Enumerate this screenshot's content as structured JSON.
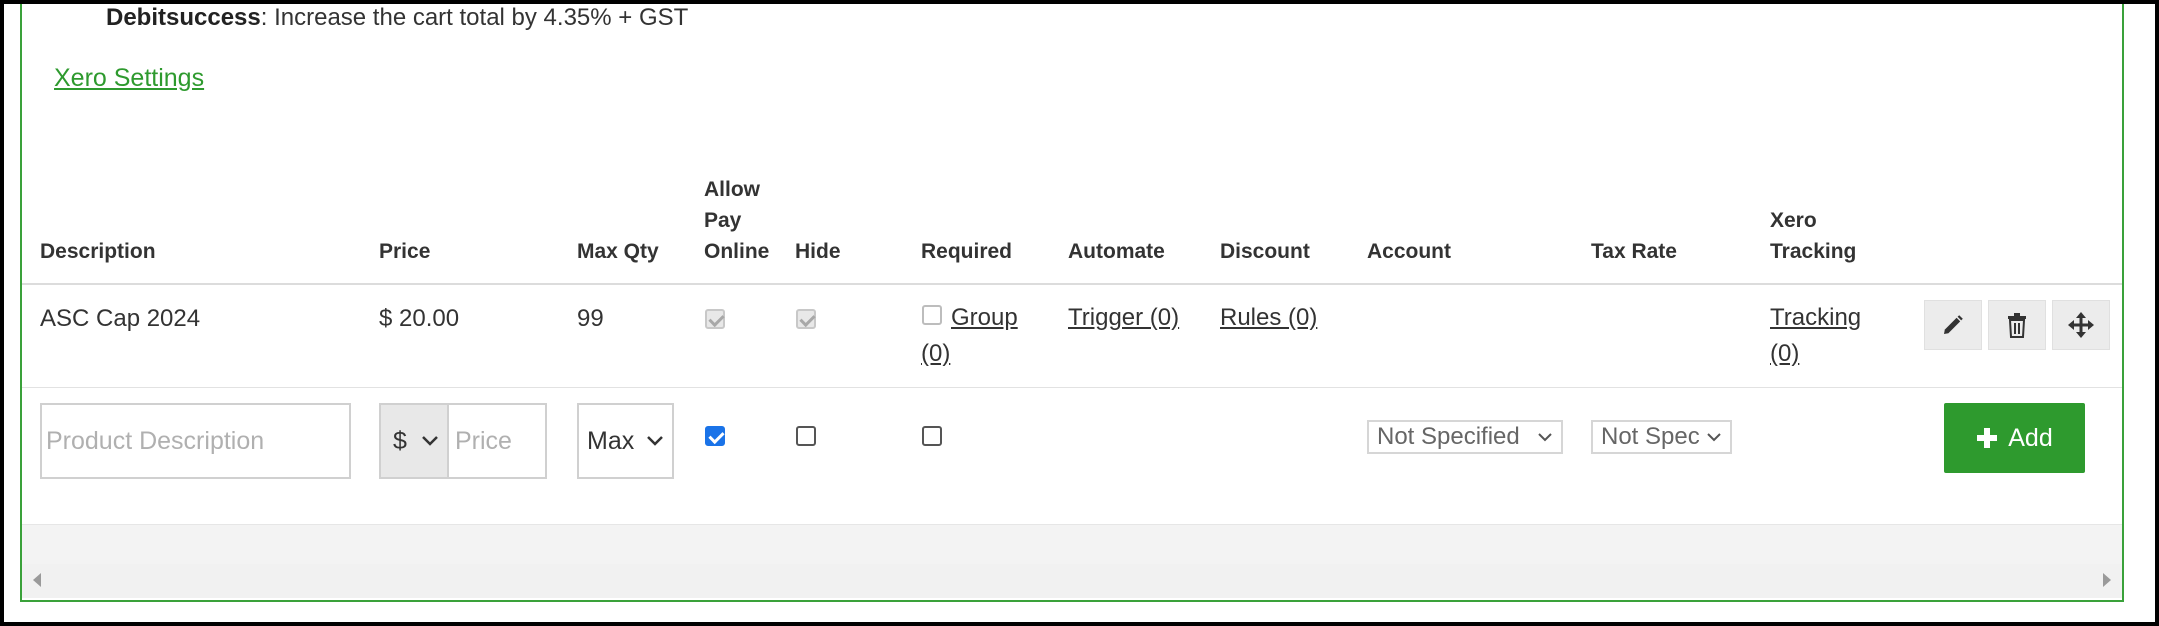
{
  "notice": {
    "provider": "Debitsuccess",
    "text": ": Increase the cart total by 4.35% + GST"
  },
  "xero_settings_link": "Xero Settings",
  "columns": {
    "description": "Description",
    "price": "Price",
    "max_qty": "Max Qty",
    "allow_pay_online": [
      "Allow",
      "Pay",
      "Online"
    ],
    "hide": "Hide",
    "required": "Required",
    "automate": "Automate",
    "discount": "Discount",
    "account": "Account",
    "tax_rate": "Tax Rate",
    "xero_tracking": [
      "Xero",
      "Tracking"
    ]
  },
  "row": {
    "description": "ASC Cap 2024",
    "price": "$ 20.00",
    "max_qty": "99",
    "allow_pay_online": true,
    "hide": true,
    "required": false,
    "group_link": [
      "Group",
      "(0)"
    ],
    "trigger_link": "Trigger (0)",
    "rules_link": "Rules (0)",
    "tracking_link": [
      "Tracking",
      "(0)"
    ]
  },
  "new_row": {
    "description_placeholder": "Product Description",
    "currency": "$",
    "price_placeholder": "Price",
    "max_placeholder": "Max",
    "allow_pay_online": true,
    "hide": false,
    "required": false,
    "account_value": "Not Specified",
    "tax_rate_value": "Not Spec",
    "add_label": "Add"
  },
  "colors": {
    "accent": "#2e9a2e",
    "checkbox_checked": "#1a73e8"
  },
  "icons": [
    "pencil-icon",
    "trash-icon",
    "move-icon",
    "plus-icon",
    "chevron-down-icon",
    "scroll-left-icon",
    "scroll-right-icon"
  ]
}
